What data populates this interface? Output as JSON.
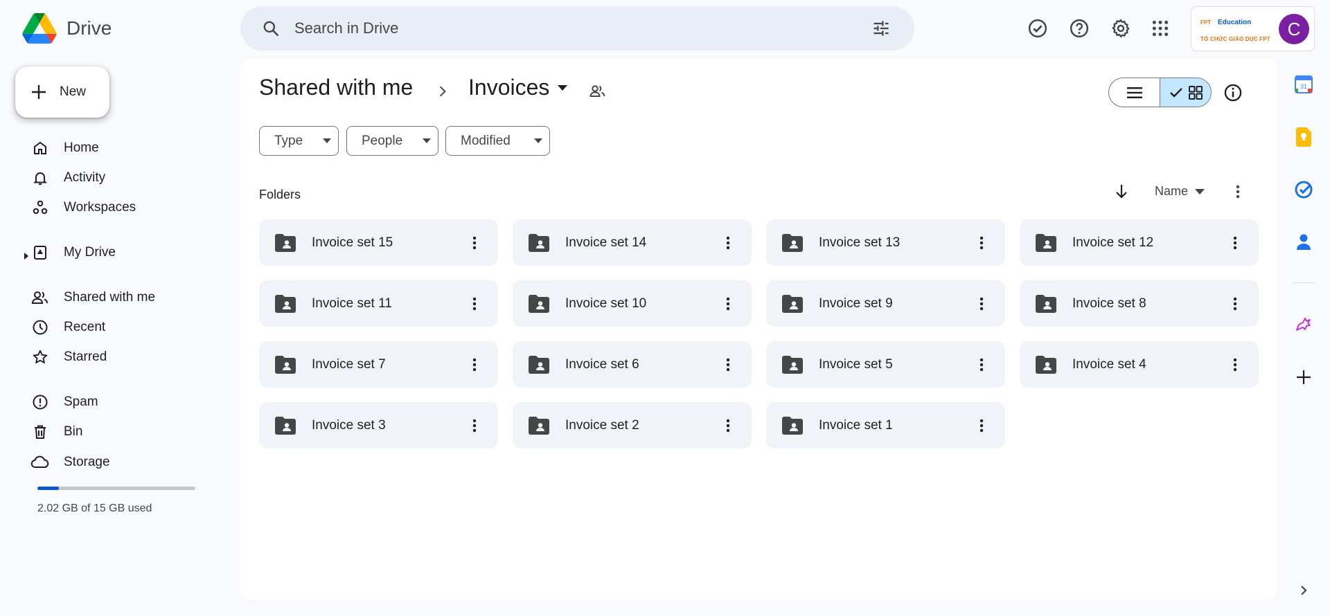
{
  "app": {
    "name": "Drive"
  },
  "search": {
    "placeholder": "Search in Drive"
  },
  "org": {
    "logo_text": "FPT",
    "sub_mark": "Education",
    "name": "TỔ CHỨC GIÁO DỤC FPT"
  },
  "account": {
    "initial": "C",
    "color": "#7b1fa2"
  },
  "nav": {
    "new_label": "New",
    "items": [
      {
        "label": "Home",
        "icon": "home-icon"
      },
      {
        "label": "Activity",
        "icon": "bell-icon"
      },
      {
        "label": "Workspaces",
        "icon": "workspaces-icon"
      },
      {
        "label": "My Drive",
        "icon": "my-drive-icon"
      },
      {
        "label": "Shared with me",
        "icon": "people-icon"
      },
      {
        "label": "Recent",
        "icon": "clock-icon"
      },
      {
        "label": "Starred",
        "icon": "star-icon"
      },
      {
        "label": "Spam",
        "icon": "spam-icon"
      },
      {
        "label": "Bin",
        "icon": "trash-icon"
      },
      {
        "label": "Storage",
        "icon": "cloud-icon"
      }
    ],
    "storage_used_fraction": 0.135,
    "storage_text": "2.02 GB of 15 GB used"
  },
  "breadcrumb": {
    "parent": "Shared with me",
    "current": "Invoices"
  },
  "filters": {
    "type": "Type",
    "people": "People",
    "modified": "Modified"
  },
  "section": {
    "title": "Folders",
    "sort_label": "Name"
  },
  "folders": [
    "Invoice set 15",
    "Invoice set 14",
    "Invoice set 13",
    "Invoice set 12",
    "Invoice set 11",
    "Invoice set 10",
    "Invoice set 9",
    "Invoice set 8",
    "Invoice set 7",
    "Invoice set 6",
    "Invoice set 5",
    "Invoice set 4",
    "Invoice set 3",
    "Invoice set 2",
    "Invoice set 1"
  ],
  "colors": {
    "accent": "#0b57d0",
    "selected_view": "#c2e7ff",
    "folder_bg": "#f0f4f9"
  }
}
